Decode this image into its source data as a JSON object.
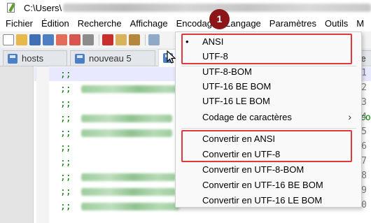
{
  "window": {
    "title_prefix": "C:\\Users\\"
  },
  "menubar": {
    "items": [
      "Fichier",
      "Édition",
      "Recherche",
      "Affichage",
      "Encodage",
      "Langage",
      "Paramètres",
      "Outils",
      "M"
    ]
  },
  "tabs": [
    {
      "label": "hosts"
    },
    {
      "label": "nouveau 5"
    },
    {
      "label": ""
    },
    {
      "label": "ve"
    }
  ],
  "editor": {
    "line_numbers": [
      "1",
      "2",
      "3",
      "4",
      "5",
      "6",
      "7",
      "8",
      "9",
      "10"
    ],
    "comment_prefix": ";;",
    "right_overflow": [
      "",
      "",
      "",
      "co",
      "",
      "",
      "",
      "",
      "",
      ""
    ]
  },
  "encoding_menu": {
    "items": [
      {
        "label": "ANSI",
        "selected_marker": "•"
      },
      {
        "label": "UTF-8"
      },
      {
        "label": "UTF-8-BOM"
      },
      {
        "label": "UTF-16 BE BOM"
      },
      {
        "label": "UTF-16 LE BOM"
      },
      {
        "label": "Codage de caractères",
        "submenu_arrow": "›"
      },
      {
        "label": "Convertir en ANSI"
      },
      {
        "label": "Convertir en UTF-8"
      },
      {
        "label": "Convertir en UTF-8-BOM"
      },
      {
        "label": "Convertir en UTF-16 BE BOM"
      },
      {
        "label": "Convertir en UTF-16 LE BOM"
      }
    ]
  },
  "annotation": {
    "badge": "1"
  },
  "colors": {
    "highlight_box": "#e0393b",
    "badge_bg": "#8b1518",
    "comment_green": "#008000",
    "line_highlight": "#e8e8ff"
  }
}
